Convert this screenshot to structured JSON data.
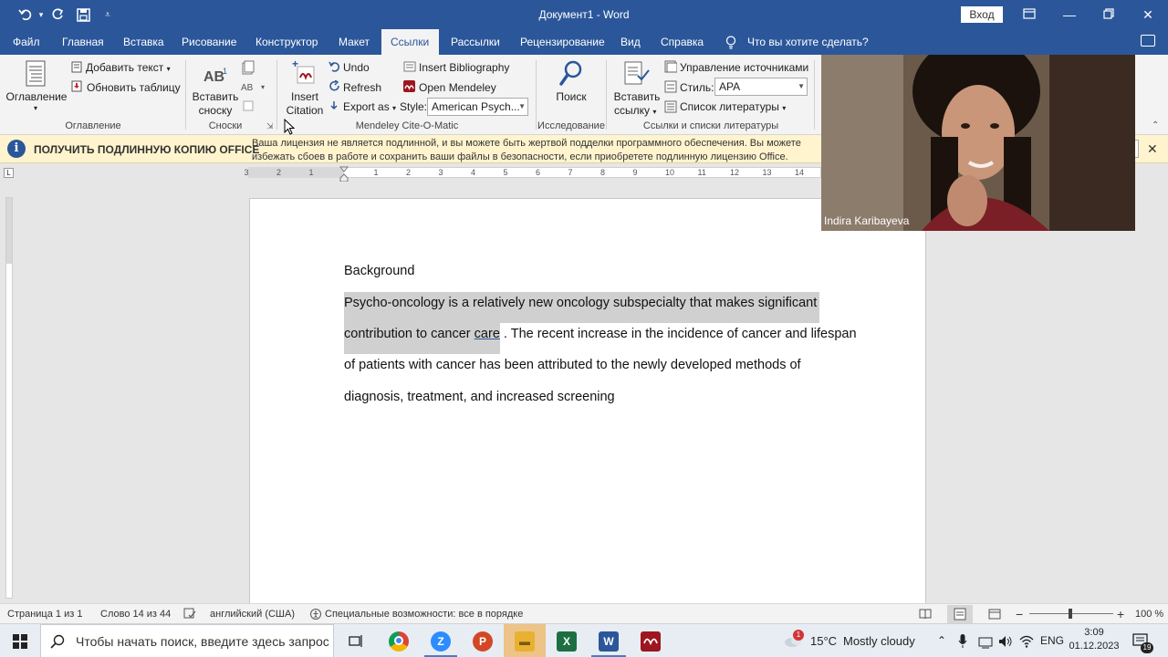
{
  "window": {
    "title": "Документ1  -  Word",
    "signin": "Вход"
  },
  "tabs": [
    "Файл",
    "Главная",
    "Вставка",
    "Рисование",
    "Конструктор",
    "Макет",
    "Ссылки",
    "Рассылки",
    "Рецензирование",
    "Вид",
    "Справка"
  ],
  "active_tab": "Ссылки",
  "tell_me": "Что вы хотите сделать?",
  "ribbon": {
    "toc": {
      "button": "Оглавление",
      "add_text": "Добавить текст",
      "update_table": "Обновить таблицу",
      "group": "Оглавление"
    },
    "footnotes": {
      "insert_line1": "Вставить",
      "insert_line2": "сноску",
      "group": "Сноски"
    },
    "mendeley": {
      "insert_line1": "Insert",
      "insert_line2": "Citation",
      "undo": "Undo",
      "refresh": "Refresh",
      "export": "Export as",
      "insert_bibliography": "Insert Bibliography",
      "open_mendeley": "Open Mendeley",
      "style_label": "Style:",
      "style_value": "American Psych...",
      "group": "Mendeley Cite-O-Matic"
    },
    "research": {
      "search": "Поиск",
      "group": "Исследование"
    },
    "citations": {
      "insert_line1": "Вставить",
      "insert_line2": "ссылку",
      "manage_sources": "Управление источниками",
      "style_label": "Стиль:",
      "style_value": "APA",
      "bibliography": "Список литературы",
      "group": "Ссылки и списки литературы"
    }
  },
  "warning": {
    "title": "ПОЛУЧИТЬ ПОДЛИННУЮ КОПИЮ OFFICE",
    "line1": "Ваша лицензия не является подлинной, и вы можете быть жертвой подделки программного обеспечения. Вы можете",
    "line2": "избежать сбоев в работе и сохранить ваши файлы в безопасности, если приобретете подлинную лицензию Office."
  },
  "ruler_numbers": [
    "3",
    "2",
    "1",
    "1",
    "2",
    "3",
    "4",
    "5",
    "6",
    "7",
    "8",
    "9",
    "10",
    "11",
    "12",
    "13",
    "14"
  ],
  "document": {
    "heading": "Background",
    "line1": "Psycho-oncology is a relatively new oncology subspecialty that makes significant",
    "line2_a": "contribution to cancer ",
    "line2_link": "care",
    "line2_b": " . The recent increase in the incidence of cancer and lifespan",
    "line3": "of patients with cancer has been attributed to the newly developed methods of",
    "line4": "diagnosis, treatment, and increased screening"
  },
  "video": {
    "participant": "Indira Karibayeva"
  },
  "status": {
    "page": "Страница 1 из 1",
    "words": "Слово 14 из 44",
    "language": "английский (США)",
    "accessibility": "Специальные возможности: все в порядке",
    "zoom": "100 %",
    "zoom_level": 1.0
  },
  "taskbar": {
    "search_placeholder": "Чтобы начать поиск, введите здесь запрос",
    "weather_temp": "15°C",
    "weather_text": "Mostly cloudy",
    "weather_badge": "1",
    "lang": "ENG",
    "time": "3:09",
    "date": "01.12.2023",
    "notif_count": "19"
  },
  "colors": {
    "word_blue": "#2b579a",
    "warning_bg": "#fff4ce",
    "mendeley_red": "#9d1620"
  }
}
